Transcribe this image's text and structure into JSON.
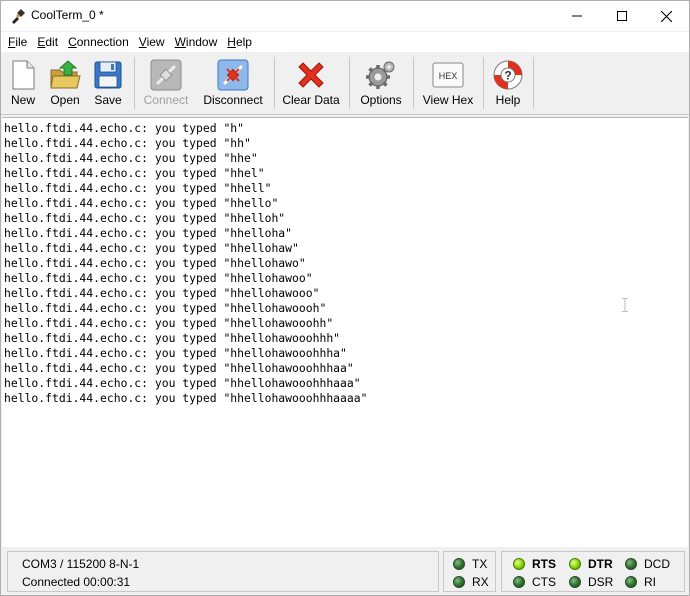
{
  "window": {
    "title": "CoolTerm_0 *"
  },
  "menu": [
    {
      "label": "File",
      "u": "F",
      "rest": "ile"
    },
    {
      "label": "Edit",
      "u": "E",
      "rest": "dit"
    },
    {
      "label": "Connection",
      "u": "C",
      "rest": "onnection"
    },
    {
      "label": "View",
      "u": "V",
      "rest": "iew"
    },
    {
      "label": "Window",
      "u": "W",
      "rest": "indow"
    },
    {
      "label": "Help",
      "u": "H",
      "rest": "elp"
    }
  ],
  "toolbar": {
    "new": "New",
    "open": "Open",
    "save": "Save",
    "connect": "Connect",
    "disconnect": "Disconnect",
    "clear_data": "Clear Data",
    "options": "Options",
    "view_hex": "View Hex",
    "hex_icon_text": "HEX",
    "help": "Help"
  },
  "terminal": {
    "lines": [
      "hello.ftdi.44.echo.c: you typed \"h\"",
      "hello.ftdi.44.echo.c: you typed \"hh\"",
      "hello.ftdi.44.echo.c: you typed \"hhe\"",
      "hello.ftdi.44.echo.c: you typed \"hhel\"",
      "hello.ftdi.44.echo.c: you typed \"hhell\"",
      "hello.ftdi.44.echo.c: you typed \"hhello\"",
      "hello.ftdi.44.echo.c: you typed \"hhelloh\"",
      "hello.ftdi.44.echo.c: you typed \"hhelloha\"",
      "hello.ftdi.44.echo.c: you typed \"hhellohaw\"",
      "hello.ftdi.44.echo.c: you typed \"hhellohawo\"",
      "hello.ftdi.44.echo.c: you typed \"hhellohawoo\"",
      "hello.ftdi.44.echo.c: you typed \"hhellohawooo\"",
      "hello.ftdi.44.echo.c: you typed \"hhellohawoooh\"",
      "hello.ftdi.44.echo.c: you typed \"hhellohawooohh\"",
      "hello.ftdi.44.echo.c: you typed \"hhellohawooohhh\"",
      "hello.ftdi.44.echo.c: you typed \"hhellohawooohhha\"",
      "hello.ftdi.44.echo.c: you typed \"hhellohawooohhhaa\"",
      "hello.ftdi.44.echo.c: you typed \"hhellohawooohhhaaa\"",
      "hello.ftdi.44.echo.c: you typed \"hhellohawooohhhaaaa\""
    ]
  },
  "status": {
    "port_settings": "COM3 / 115200 8-N-1",
    "connection_state": "Connected 00:00:31",
    "leds": {
      "tx": "TX",
      "rx": "RX",
      "rts": "RTS",
      "cts": "CTS",
      "dtr": "DTR",
      "dsr": "DSR",
      "dcd": "DCD",
      "ri": "RI"
    }
  },
  "colors": {
    "led_on": "#7fd400",
    "led_off": "#2e6b2e",
    "clear_red": "#e0301e",
    "disconnect_blue": "#3a78c8"
  }
}
